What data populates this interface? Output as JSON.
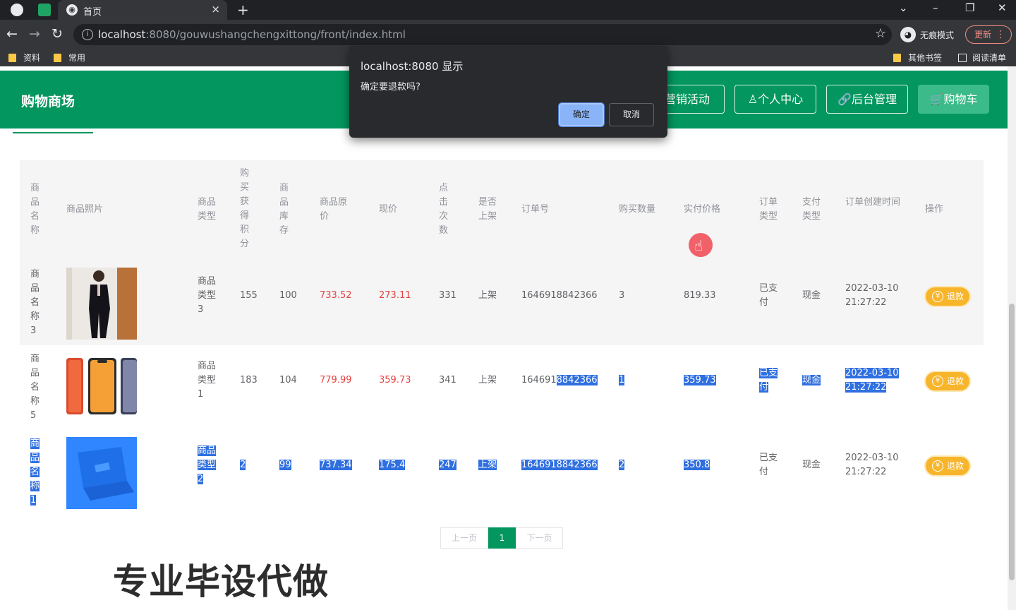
{
  "browser": {
    "tab_title": "首页",
    "tab_close": "×",
    "new_tab": "+",
    "url_host": "localhost",
    "url_rest": ":8080/gouwushangchengxittong/front/index.html",
    "incognito_label": "无痕模式",
    "update_label": "更新",
    "bookmarks": {
      "b1": "资料",
      "b2": "常用",
      "other": "其他书签",
      "reading": "阅读清单"
    }
  },
  "dialog": {
    "title": "localhost:8080 显示",
    "message": "确定要退款吗?",
    "ok": "确定",
    "cancel": "取消"
  },
  "header": {
    "brand": "购物商场",
    "nav": {
      "marketing": "营销活动",
      "profile": "个人中心",
      "admin": "后台管理",
      "cart": "购物车"
    }
  },
  "table": {
    "headers": {
      "name": "商品名称",
      "photo": "商品照片",
      "type": "商品类型",
      "points": "购买获得积分",
      "stock": "商品库存",
      "orig": "商品原价",
      "price": "现价",
      "clicks": "点击次数",
      "shelf": "是否上架",
      "order_no": "订单号",
      "qty": "购买数量",
      "paid": "实付价格",
      "order_type": "订单类型",
      "pay_type": "支付类型",
      "created": "订单创建时间",
      "action": "操作"
    },
    "rows": [
      {
        "name": "商品名称3",
        "type": "商品类型3",
        "points": "155",
        "stock": "100",
        "orig": "733.52",
        "price": "273.11",
        "clicks": "331",
        "shelf": "上架",
        "order_no_a": "1646918842366",
        "order_no_b": "",
        "qty": "3",
        "paid": "819.33",
        "order_type": "已支付",
        "pay_type": "现金",
        "date": "2022-03-10",
        "time": "21:27:22",
        "btn": "退款"
      },
      {
        "name": "商品名称5",
        "type": "商品类型1",
        "points": "183",
        "stock": "104",
        "orig": "779.99",
        "price": "359.73",
        "clicks": "341",
        "shelf": "上架",
        "order_no_a": "164691",
        "order_no_b": "8842366",
        "qty": "1",
        "paid": "359.73",
        "order_type": "已支付",
        "pay_type": "现金",
        "date": "2022-03-10",
        "time": "21:27:22",
        "btn": "退款"
      },
      {
        "name": "商品名称1",
        "type": "商品类型2",
        "points": "2",
        "stock": "99",
        "orig": "737.34",
        "price": "175.4",
        "clicks": "247",
        "shelf": "上架",
        "order_no_a": "1646918842366",
        "order_no_b": "",
        "qty": "2",
        "paid": "350.8",
        "order_type": "已支付",
        "pay_type": "现金",
        "date": "2022-03-10",
        "time": "21:27:22",
        "btn": "退款"
      }
    ]
  },
  "pagination": {
    "prev": "上一页",
    "current": "1",
    "next": "下一页"
  },
  "watermark": "专业毕设代做"
}
